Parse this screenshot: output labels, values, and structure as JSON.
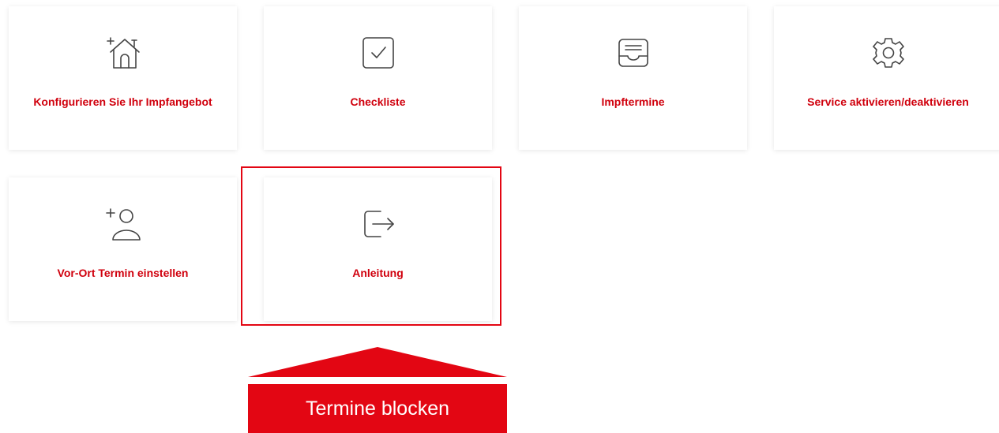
{
  "tiles": [
    {
      "label": "Konfigurieren Sie Ihr Impfangebot",
      "icon": "house-add-icon"
    },
    {
      "label": "Checkliste",
      "icon": "checkbox-icon"
    },
    {
      "label": "Impftermine",
      "icon": "inbox-tray-icon"
    },
    {
      "label": "Service aktivieren/deaktivieren",
      "icon": "gear-icon"
    },
    {
      "label": "Vor-Ort Termin einstellen",
      "icon": "add-person-icon"
    },
    {
      "label": "Anleitung",
      "icon": "logout-arrow-icon"
    }
  ],
  "callout": {
    "text": "Termine blocken"
  },
  "colors": {
    "accent": "#d0000d",
    "banner": "#e30613",
    "icon_stroke": "#444444"
  }
}
